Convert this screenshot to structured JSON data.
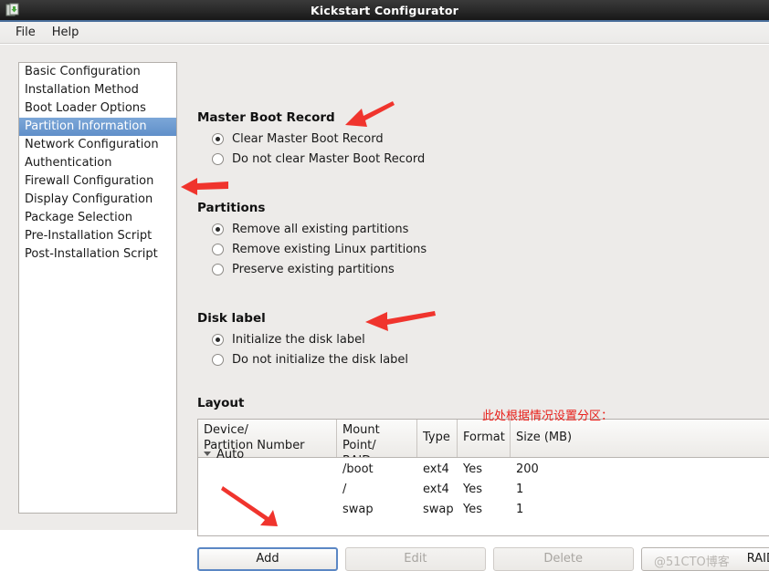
{
  "window": {
    "title": "Kickstart Configurator",
    "icon": "kickstart-app-icon"
  },
  "menubar": {
    "items": [
      {
        "label": "File"
      },
      {
        "label": "Help"
      }
    ]
  },
  "sidebar": {
    "items": [
      {
        "label": "Basic Configuration",
        "selected": false
      },
      {
        "label": "Installation Method",
        "selected": false
      },
      {
        "label": "Boot Loader Options",
        "selected": false
      },
      {
        "label": "Partition Information",
        "selected": true
      },
      {
        "label": "Network Configuration",
        "selected": false
      },
      {
        "label": "Authentication",
        "selected": false
      },
      {
        "label": "Firewall Configuration",
        "selected": false
      },
      {
        "label": "Display Configuration",
        "selected": false
      },
      {
        "label": "Package Selection",
        "selected": false
      },
      {
        "label": "Pre-Installation Script",
        "selected": false
      },
      {
        "label": "Post-Installation Script",
        "selected": false
      }
    ]
  },
  "mbr": {
    "title": "Master Boot Record",
    "options": [
      {
        "label": "Clear Master Boot Record",
        "selected": true
      },
      {
        "label": "Do not clear Master Boot Record",
        "selected": false
      }
    ]
  },
  "partitions": {
    "title": "Partitions",
    "options": [
      {
        "label": "Remove all existing partitions",
        "selected": true
      },
      {
        "label": "Remove existing Linux partitions",
        "selected": false
      },
      {
        "label": "Preserve existing partitions",
        "selected": false
      }
    ]
  },
  "disklabel": {
    "title": "Disk label",
    "options": [
      {
        "label": "Initialize the disk label",
        "selected": true
      },
      {
        "label": "Do not initialize the disk label",
        "selected": false
      }
    ]
  },
  "layout": {
    "title": "Layout",
    "annotation": "此处根据情况设置分区：",
    "columns": [
      "Device/\nPartition Number",
      "Mount Point/\nRAID",
      "Type",
      "Format",
      "Size (MB)"
    ],
    "parent_row": {
      "label": "Auto"
    },
    "rows": [
      {
        "device": "",
        "mount": "/boot",
        "type": "ext4",
        "format": "Yes",
        "size": "200"
      },
      {
        "device": "",
        "mount": "/",
        "type": "ext4",
        "format": "Yes",
        "size": "1"
      },
      {
        "device": "",
        "mount": "swap",
        "type": "swap",
        "format": "Yes",
        "size": "1"
      }
    ]
  },
  "buttons": [
    {
      "label": "Add",
      "state": "focused"
    },
    {
      "label": "Edit",
      "state": "disabled"
    },
    {
      "label": "Delete",
      "state": "disabled"
    },
    {
      "label": "RAID",
      "state": "clipped"
    }
  ],
  "watermark": {
    "text": "@51CTO博客"
  },
  "colors": {
    "accent_blue": "#608fc9",
    "annotation_red": "#e8211c",
    "titlebar_dark": "#2c2c2c",
    "pane_bg": "#edebe9"
  }
}
